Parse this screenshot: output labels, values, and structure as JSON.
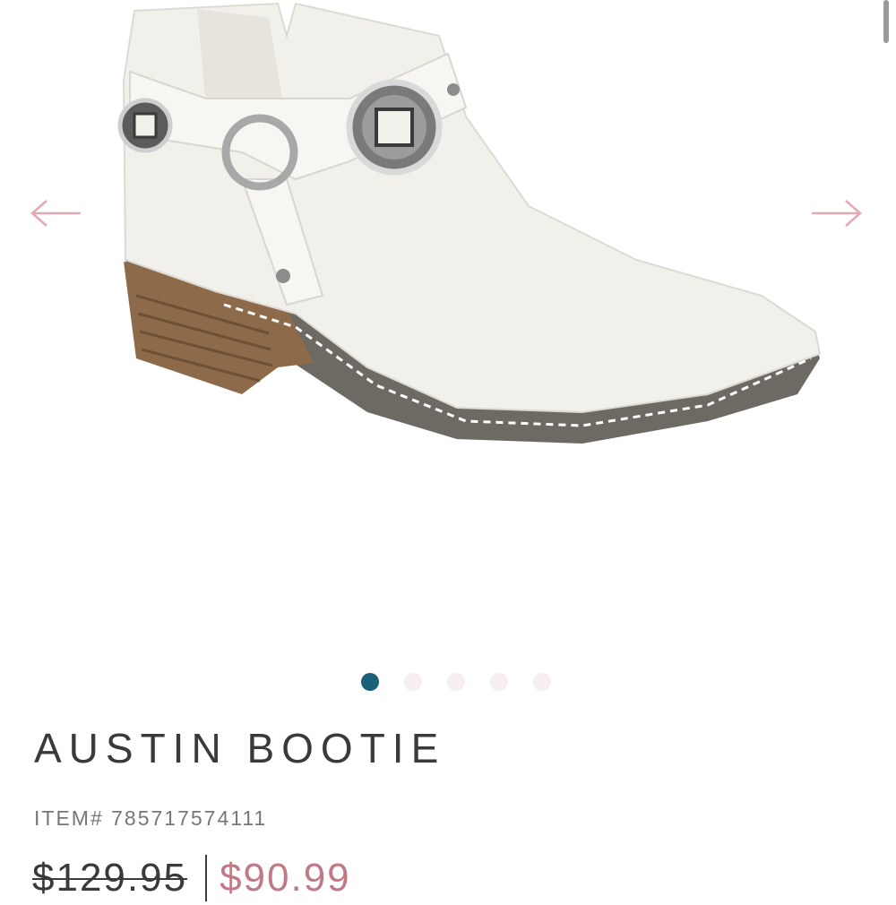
{
  "gallery": {
    "image_alt": "white leather ankle bootie with silver concho harness",
    "prev_icon": "arrow-left-icon",
    "next_icon": "arrow-right-icon",
    "arrow_color": "#e3a9b4",
    "active_slide": 1,
    "total_slides": 5,
    "active_dot_color": "#1a6079",
    "inactive_dot_color": "#f6eef1"
  },
  "product": {
    "title": "AUSTIN BOOTIE",
    "item_number": "ITEM# 785717574111",
    "original_price": "$129.95",
    "sale_price": "$90.99",
    "sale_color": "#c07a86"
  }
}
